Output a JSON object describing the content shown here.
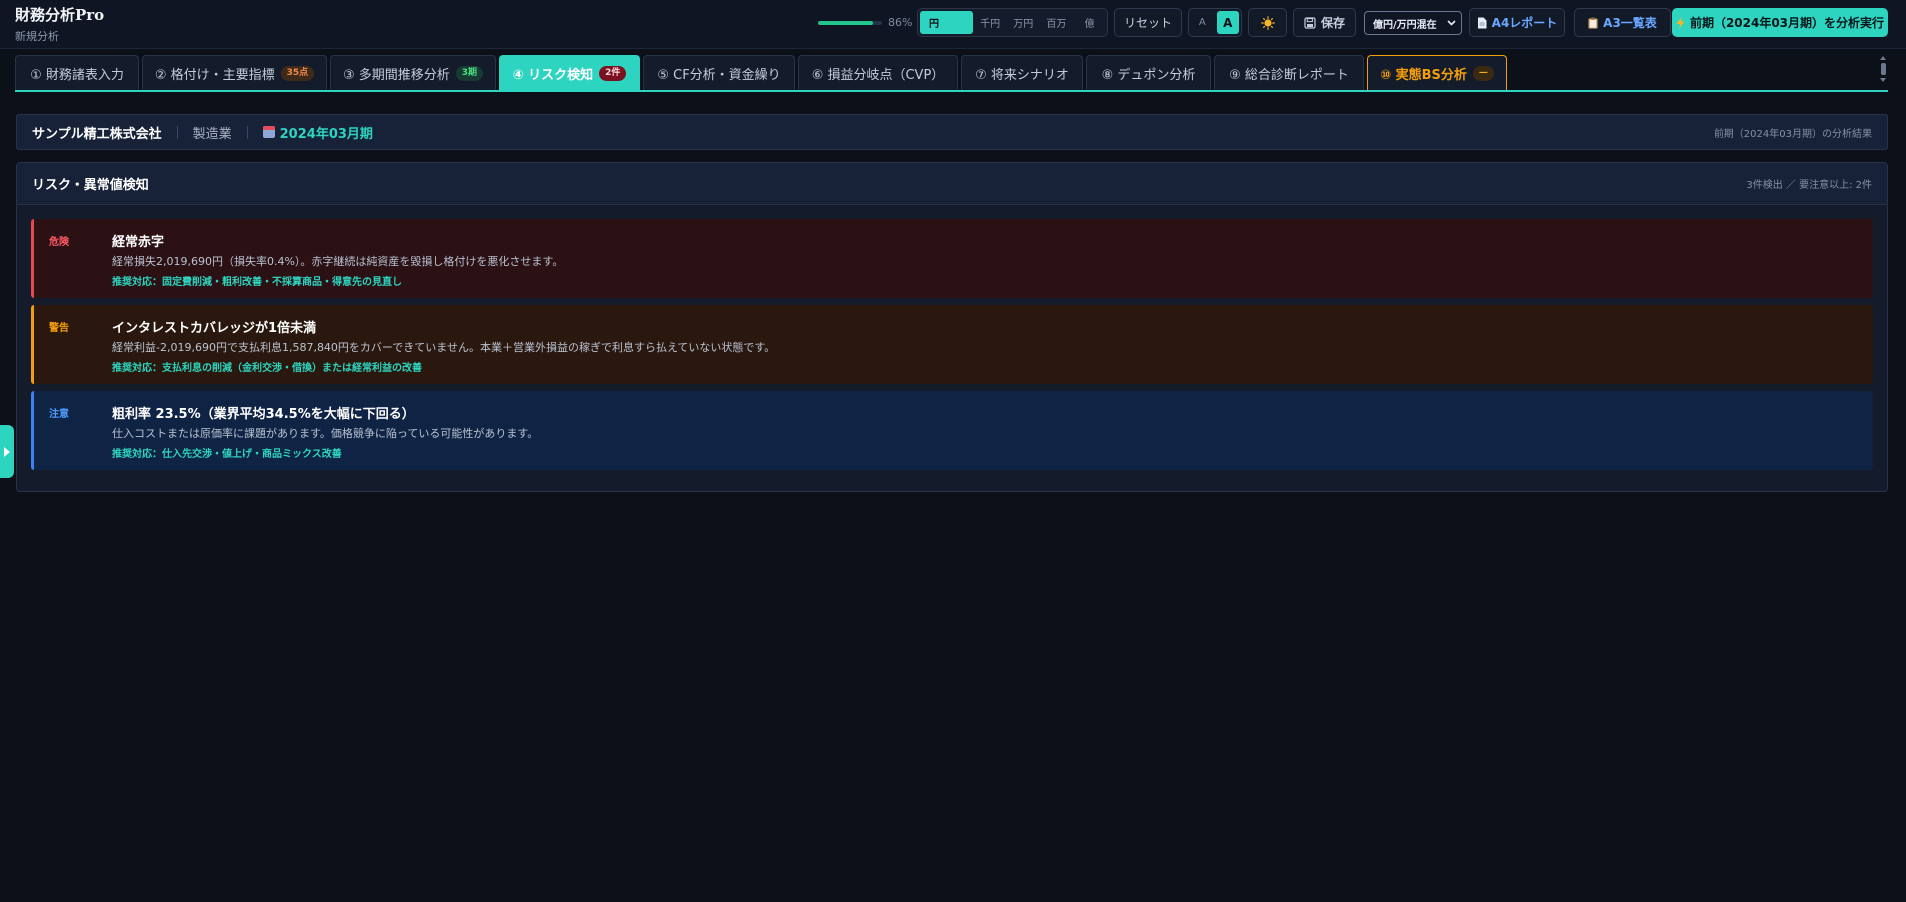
{
  "app": {
    "title": "財務分析Pro",
    "subtitle": "新規分析"
  },
  "progress": {
    "value": 0.86,
    "label": "86%"
  },
  "units": [
    {
      "label": "円",
      "active": true
    },
    {
      "label": "千円",
      "active": false
    },
    {
      "label": "万円",
      "active": false
    },
    {
      "label": "百万",
      "active": false
    },
    {
      "label": "億",
      "active": false
    }
  ],
  "toolbar": {
    "reset_label": "リセット",
    "font_small": "A",
    "font_large": "A",
    "theme_icon": "sun-icon",
    "save_label": "保存",
    "mix_select": "億円/万円混在",
    "a4_label": "A4レポート",
    "a3_label": "A3一覧表",
    "run_label": "前期（2024年03月期）を分析実行"
  },
  "tabs": [
    {
      "label": "① 財務諸表入力",
      "badge": ""
    },
    {
      "label": "② 格付け・主要指標",
      "badge": "35点"
    },
    {
      "label": "③ 多期間推移分析",
      "badge": "3期"
    },
    {
      "label": "④ リスク検知",
      "badge": "2件"
    },
    {
      "label": "⑤ CF分析・資金繰り",
      "badge": ""
    },
    {
      "label": "⑥ 損益分岐点（CVP）",
      "badge": ""
    },
    {
      "label": "⑦ 将来シナリオ",
      "badge": ""
    },
    {
      "label": "⑧ デュポン分析",
      "badge": ""
    },
    {
      "label": "⑨ 総合診断レポート",
      "badge": ""
    },
    {
      "label": "⑩ 実態BS分析",
      "badge": "—"
    }
  ],
  "company": {
    "name": "サンプル精工株式会社",
    "industry": "製造業",
    "period": "2024年03月期",
    "result_note": "前期（2024年03月期）の分析結果"
  },
  "risk": {
    "title": "リスク・異常値検知",
    "summary": "3件検出 ／ 要注意以上: 2件",
    "alerts": [
      {
        "level": "危険",
        "title": "経常赤字",
        "desc": "経常損失2,019,690円（損失率0.4%）。赤字継続は純資産を毀損し格付けを悪化させます。",
        "reco": "推奨対応：固定費削減・粗利改善・不採算商品・得意先の見直し"
      },
      {
        "level": "警告",
        "title": "インタレストカバレッジが1倍未満",
        "desc": "経常利益-2,019,690円で支払利息1,587,840円をカバーできていません。本業＋営業外損益の稼ぎで利息すら払えていない状態です。",
        "reco": "推奨対応：支払利息の削減（金利交渉・借換）または経常利益の改善"
      },
      {
        "level": "注意",
        "title": "粗利率 23.5%（業界平均34.5%を大幅に下回る）",
        "desc": "仕入コストまたは原価率に課題があります。価格競争に陥っている可能性があります。",
        "reco": "推奨対応：仕入先交渉・値上げ・商品ミックス改善"
      }
    ]
  }
}
